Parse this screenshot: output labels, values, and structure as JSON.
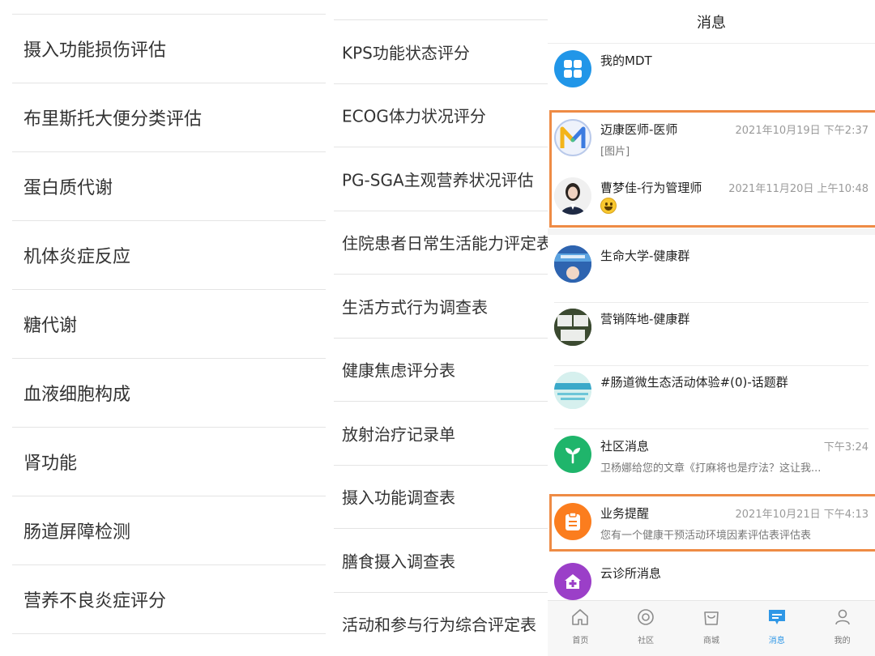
{
  "left_list": {
    "items": [
      "摄入功能损伤评估",
      "布里斯托大便分类评估",
      "蛋白质代谢",
      "机体炎症反应",
      "糖代谢",
      "血液细胞构成",
      "肾功能",
      "肠道屏障检测",
      "营养不良炎症评分"
    ]
  },
  "middle_list": {
    "items": [
      "KPS功能状态评分",
      "ECOG体力状况评分",
      "PG-SGA主观营养状况评估",
      "住院患者日常生活能力评定表",
      "生活方式行为调查表",
      "健康焦虑评分表",
      "放射治疗记录单",
      "摄入功能调查表",
      "膳食摄入调查表",
      "活动和参与行为综合评定表"
    ]
  },
  "messages_screen": {
    "title": "消息",
    "accent_color": "#ee8b45",
    "messages": [
      {
        "name": "我的MDT",
        "time": "",
        "preview": "",
        "icon": "grid-icon"
      },
      {
        "name": "迈康医师-医师",
        "time": "2021年10月19日 下午2:37",
        "preview": "[图片]",
        "icon": "m-logo-avatar"
      },
      {
        "name": "曹梦佳-行为管理师",
        "time": "2021年11月20日 上午10:48",
        "preview": "",
        "icon": "person-avatar"
      },
      {
        "name": "生命大学-健康群",
        "time": "",
        "preview": "",
        "icon": "group-avatar"
      },
      {
        "name": "营销阵地-健康群",
        "time": "",
        "preview": "",
        "icon": "group-avatar"
      },
      {
        "name": "#肠道微生态活动体验#(0)-话题群",
        "time": "",
        "preview": "",
        "icon": "topic-avatar"
      },
      {
        "name": "社区消息",
        "time": "下午3:24",
        "preview": "卫杨娜给您的文章《打麻将也是疗法？这让我...",
        "icon": "leaf-icon"
      },
      {
        "name": "业务提醒",
        "time": "2021年10月21日 下午4:13",
        "preview": "您有一个健康干预活动环境因素评估表评估表",
        "icon": "clipboard-icon"
      },
      {
        "name": "云诊所消息",
        "time": "",
        "preview": "",
        "icon": "house-plus-icon"
      }
    ],
    "tabs": [
      "首页",
      "社区",
      "商城",
      "消息",
      "我的"
    ],
    "active_tab": "消息"
  }
}
